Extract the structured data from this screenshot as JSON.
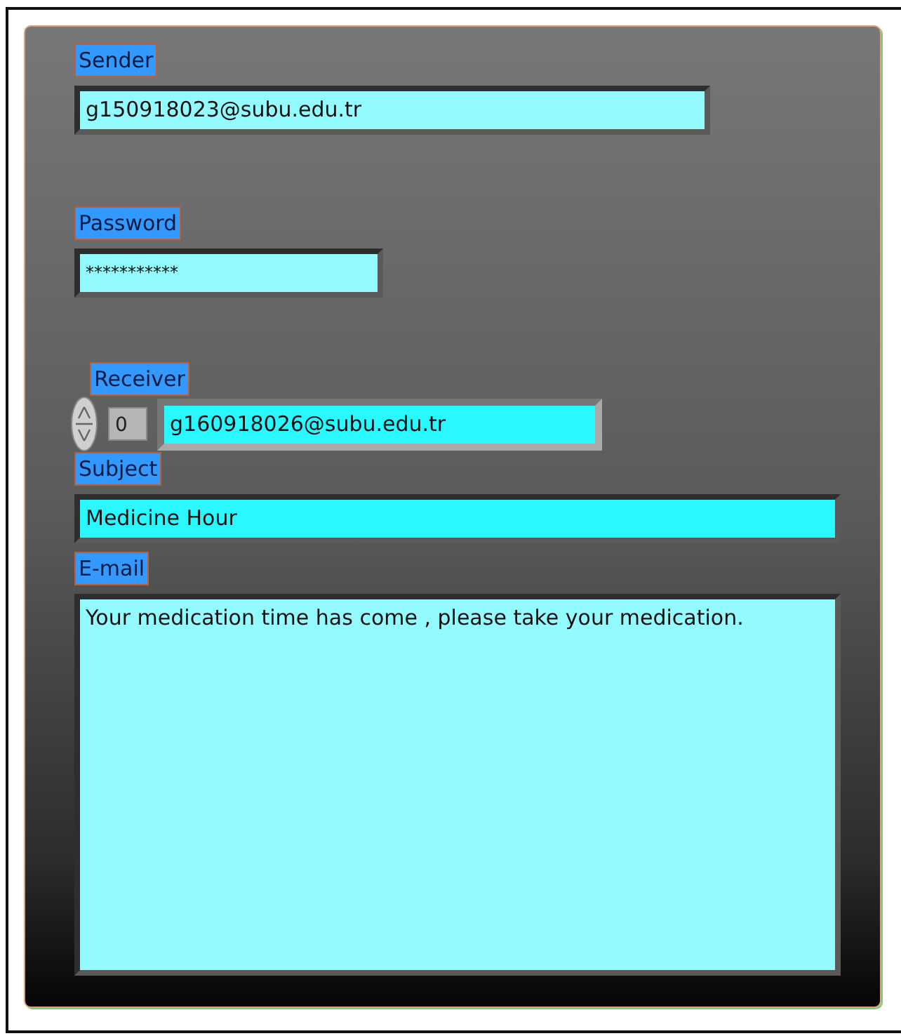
{
  "fields": [
    {
      "kind": "text",
      "label": "Sender",
      "value": "g150918023@subu.edu.tr",
      "color": "#93fbfd"
    },
    {
      "kind": "password",
      "label": "Password",
      "value": "***********",
      "color": "#93fbfd"
    },
    {
      "kind": "array",
      "label": "Receiver",
      "index": "0",
      "value": "g160918026@subu.edu.tr",
      "color": "#2af8ff"
    },
    {
      "kind": "text",
      "label": "Subject",
      "value": "Medicine Hour",
      "color": "#2af8ff"
    },
    {
      "kind": "textarea",
      "label": "E-mail",
      "value": "Your medication time has come , please take your medication.",
      "color": "#93fbfd"
    }
  ]
}
